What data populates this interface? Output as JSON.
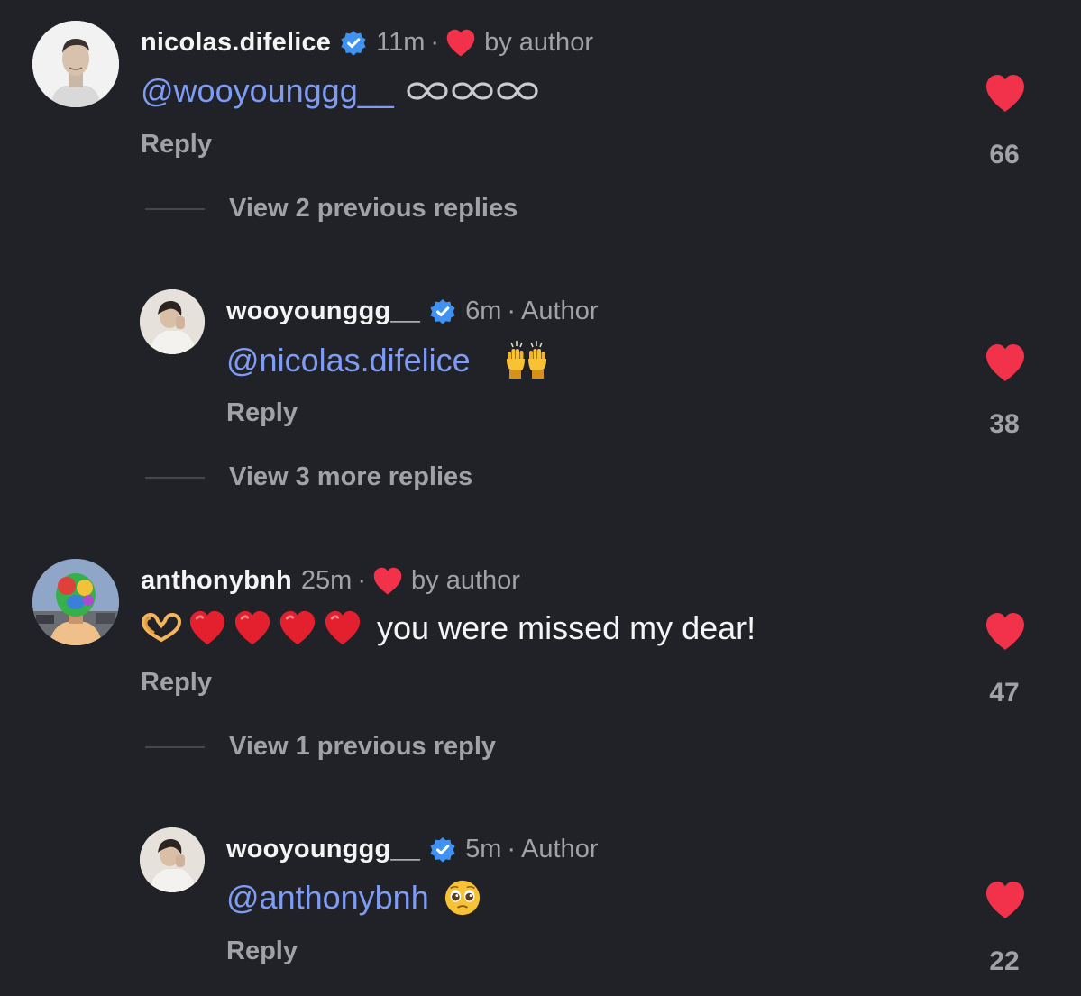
{
  "colors": {
    "background": "#212227",
    "mention": "#7f9cf5",
    "heart": "#f2314a",
    "verified": "#3f92f2",
    "muted": "#a0a2a8"
  },
  "comments": [
    {
      "username": "nicolas.difelice",
      "verified": true,
      "time": "11m",
      "badge": "by author",
      "mention": "@wooyounggg__",
      "text": "",
      "emoji": "infinity-symbols",
      "reply_label": "Reply",
      "likes": "66",
      "view_replies": "View 2 previous replies"
    },
    {
      "username": "wooyounggg__",
      "verified": true,
      "time": "6m",
      "badge": "Author",
      "mention": "@nicolas.difelice",
      "text": "",
      "emoji": "raising-hands",
      "reply_label": "Reply",
      "likes": "38",
      "view_replies": "View 3 more replies"
    },
    {
      "username": "anthonybnh",
      "verified": false,
      "time": "25m",
      "badge": "by author",
      "mention": "",
      "text": "you were missed my dear!",
      "emoji": "heart-hands-and-red-hearts",
      "reply_label": "Reply",
      "likes": "47",
      "view_replies": "View 1 previous reply"
    },
    {
      "username": "wooyounggg__",
      "verified": true,
      "time": "5m",
      "badge": "Author",
      "mention": "@anthonybnh",
      "text": "",
      "emoji": "pleading-face",
      "reply_label": "Reply",
      "likes": "22"
    }
  ],
  "icons": {
    "verified": "verified-badge-icon",
    "heart": "heart-icon",
    "avatar": "avatar"
  }
}
